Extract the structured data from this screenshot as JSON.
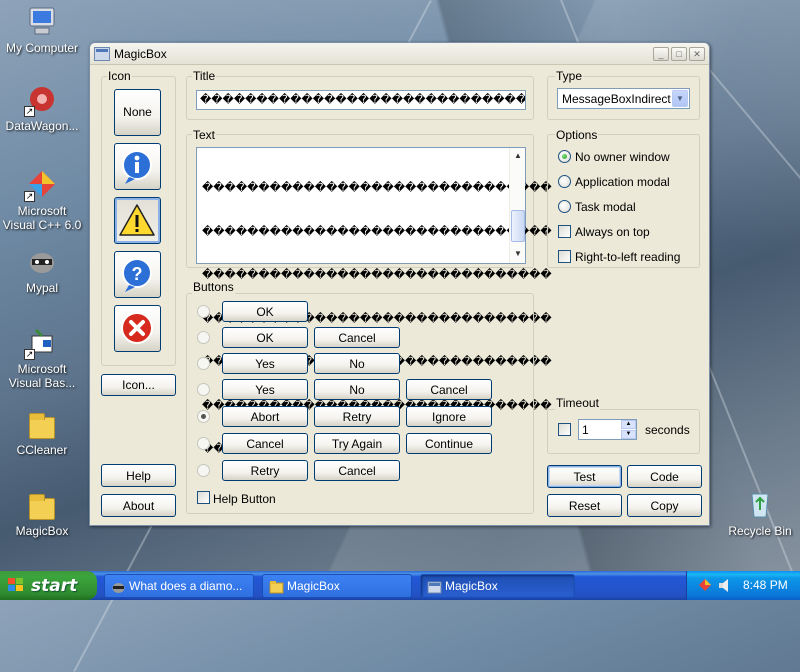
{
  "desktop": {
    "icons": [
      {
        "label": "My Computer"
      },
      {
        "label": "DataWagon..."
      },
      {
        "label": "Microsoft Visual C++ 6.0"
      },
      {
        "label": "Mypal"
      },
      {
        "label": "Microsoft Visual Bas..."
      },
      {
        "label": "CCleaner"
      },
      {
        "label": "MagicBox"
      },
      {
        "label": "Recycle Bin"
      }
    ]
  },
  "window": {
    "title": "MagicBox",
    "minimize": "_",
    "maximize": "□",
    "close": "✕"
  },
  "icon_group": {
    "label": "Icon",
    "none_label": "None",
    "icon_button_label": "Icon...",
    "selected": "warning"
  },
  "title_group": {
    "label": "Title",
    "value": "��������������������������������"
  },
  "text_group": {
    "label": "Text",
    "lines": [
      "�������������������������������",
      "�������������������������������",
      "�������������������������������",
      "�������������������������������",
      "�������������������������������",
      "�������������������������������",
      "�������"
    ]
  },
  "buttons_group": {
    "label": "Buttons",
    "selected_row": 4,
    "rows": [
      [
        "OK"
      ],
      [
        "OK",
        "Cancel"
      ],
      [
        "Yes",
        "No"
      ],
      [
        "Yes",
        "No",
        "Cancel"
      ],
      [
        "Abort",
        "Retry",
        "Ignore"
      ],
      [
        "Cancel",
        "Try Again",
        "Continue"
      ],
      [
        "Retry",
        "Cancel"
      ]
    ],
    "help_button_label": "Help Button",
    "help_button_checked": false
  },
  "type_group": {
    "label": "Type",
    "selected": "MessageBoxIndirect"
  },
  "options_group": {
    "label": "Options",
    "radios": [
      {
        "label": "No owner window",
        "checked": true
      },
      {
        "label": "Application modal",
        "checked": false
      },
      {
        "label": "Task modal",
        "checked": false
      }
    ],
    "checks": [
      {
        "label": "Always on top",
        "checked": false
      },
      {
        "label": "Right-to-left reading",
        "checked": false
      }
    ]
  },
  "timeout_group": {
    "label": "Timeout",
    "enabled": false,
    "value": "1",
    "unit": "seconds"
  },
  "actions": {
    "help": "Help",
    "about": "About",
    "test": "Test",
    "code": "Code",
    "reset": "Reset",
    "copy": "Copy"
  },
  "taskbar": {
    "start": "start",
    "tasks": [
      {
        "label": "What does a diamo..."
      },
      {
        "label": "MagicBox"
      },
      {
        "label": "MagicBox",
        "active": true
      }
    ],
    "clock": "8:48 PM"
  },
  "colors": {
    "xp_blue": "#245edb",
    "start_green": "#3ca53c",
    "window_face": "#ece9d8"
  }
}
